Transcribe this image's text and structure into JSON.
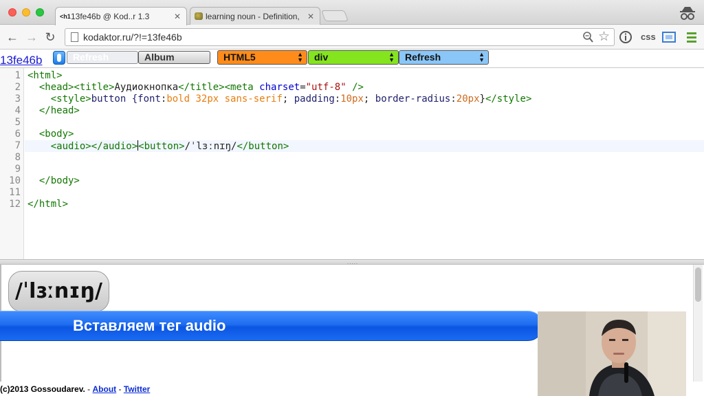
{
  "browser": {
    "tabs": [
      {
        "favicon": "<h1",
        "title": "13fe46b @ Kod..r 1.3"
      },
      {
        "title": "learning noun - Definition,"
      }
    ],
    "url": "kodaktor.ru/?!=13fe46b",
    "css_label": "css"
  },
  "appbar": {
    "code_link": "13fe46b",
    "ghost_button": "Refresh",
    "album_button": "Album",
    "select_html5": "HTML5",
    "select_div": "div",
    "select_refresh": "Refresh"
  },
  "editor": {
    "line_numbers": [
      "1",
      "2",
      "3",
      "4",
      "5",
      "6",
      "7",
      "8",
      "9",
      "10",
      "11",
      "12"
    ],
    "lines": {
      "l1": "<html>",
      "l2a": "  <head><title>",
      "l2b": "Аудиокнопка",
      "l2c": "</title><meta ",
      "l2d": "charset",
      "l2e": "=",
      "l2f": "\"utf-8\"",
      "l2g": " />",
      "l3a": "    <style>",
      "l3b": "button {",
      "l3c": "font",
      "l3d": ":",
      "l3e": "bold 32px sans-serif",
      "l3f": "; ",
      "l3g": "padding",
      "l3h": ":",
      "l3i": "10px",
      "l3j": "; ",
      "l3k": "border-radius",
      "l3l": ":",
      "l3m": "20px",
      "l3n": "}",
      "l3o": "</style>",
      "l4": "  </head>",
      "l6": "  <body>",
      "l7a": "    <audio></audio>",
      "l7b": "<button>",
      "l7c": "/ˈlɜːnɪŋ/",
      "l7d": "</button>",
      "l10": "  </body>",
      "l12": "</html>"
    }
  },
  "preview": {
    "button_text": "/ˈlɜːnɪŋ/"
  },
  "banner": {
    "text": "Вставляем тег audio"
  },
  "footer": {
    "copyright": "(c)2013 Gossoudarev.",
    "sep1": " - ",
    "about": "About",
    "sep2": " - ",
    "twitter": "Twitter"
  },
  "colors": {
    "html5_select": "#ff8c1a",
    "div_select": "#84e41e",
    "refresh_select": "#8ac6f7",
    "banner_blue": "#1f6df0",
    "code_link": "#1a1ad4"
  }
}
